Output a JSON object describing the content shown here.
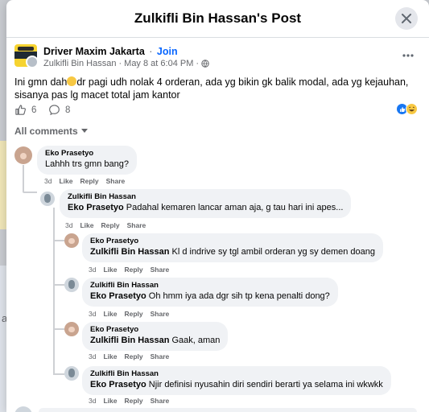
{
  "modal": {
    "title": "Zulkifli Bin Hassan's Post"
  },
  "post": {
    "group_name": "Driver Maxim Jakarta",
    "join_label": "Join",
    "author": "Zulkifli Bin Hassan",
    "date": "May 8 at 6:04 PM",
    "text_before_emoji": "Ini gmn dah",
    "text_after_emoji": "dr pagi udh nolak 4 orderan, ada yg bikin gk balik modal, ada yg kejauhan, sisanya pas lg macet total jam kantor",
    "reaction_count": "6",
    "comment_count": "8"
  },
  "all_comments_label": "All comments",
  "comments": [
    {
      "name": "Eko Prasetyo",
      "mention": "",
      "text": "Lahhh trs gmn bang?",
      "time": "3d",
      "like": "Like",
      "reply": "Reply",
      "share": "Share"
    },
    {
      "name": "Zulkifli Bin Hassan",
      "mention": "Eko Prasetyo",
      "text": "Padahal kemaren lancar aman aja, g tau hari ini apes...",
      "time": "3d",
      "like": "Like",
      "reply": "Reply",
      "share": "Share"
    },
    {
      "name": "Eko Prasetyo",
      "mention": "Zulkifli Bin Hassan",
      "text": "Kl d indrive sy tgl ambil orderan yg sy demen doang",
      "time": "3d",
      "like": "Like",
      "reply": "Reply",
      "share": "Share"
    },
    {
      "name": "Zulkifli Bin Hassan",
      "mention": "Eko Prasetyo",
      "text": "Oh hmm iya ada dgr sih tp kena penalti dong?",
      "time": "3d",
      "like": "Like",
      "reply": "Reply",
      "share": "Share"
    },
    {
      "name": "Eko Prasetyo",
      "mention": "Zulkifli Bin Hassan",
      "text": "Gaak, aman",
      "time": "3d",
      "like": "Like",
      "reply": "Reply",
      "share": "Share"
    },
    {
      "name": "Zulkifli Bin Hassan",
      "mention": "Eko Prasetyo",
      "text": "Njir definisi nyusahin diri sendiri berarti ya selama ini wkwkk",
      "time": "3d",
      "like": "Like",
      "reply": "Reply",
      "share": "Share"
    }
  ],
  "backdrop_text": "a"
}
